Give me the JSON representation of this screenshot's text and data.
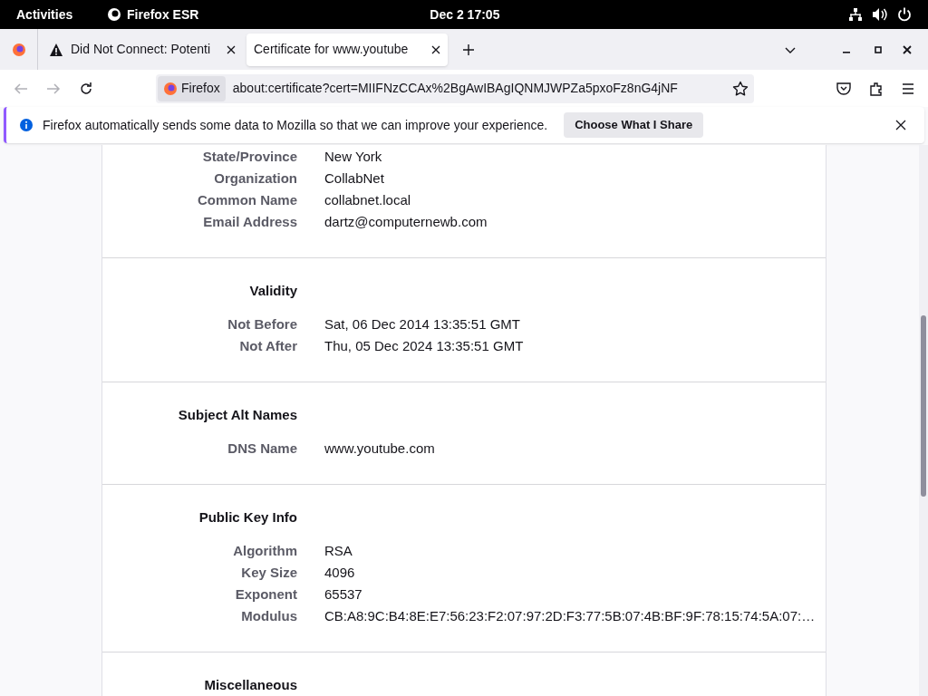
{
  "top_bar": {
    "activities": "Activities",
    "app_name": "Firefox ESR",
    "clock": "Dec 2  17:05"
  },
  "tabs": [
    {
      "title": "Did Not Connect: Potenti",
      "kind": "warning",
      "selected": false
    },
    {
      "title": "Certificate for www.youtube",
      "kind": "page",
      "selected": true
    }
  ],
  "address_bar": {
    "identity": "Firefox",
    "url": "about:certificate?cert=MIIFNzCCAx%2BgAwIBAgIQNMJWPZa5pxoFz8nG4jNF"
  },
  "notification": {
    "message": "Firefox automatically sends some data to Mozilla so that we can improve your experience.",
    "button": "Choose What I Share"
  },
  "sections": [
    {
      "rows": [
        {
          "label": "State/Province",
          "value": "New York"
        },
        {
          "label": "Organization",
          "value": "CollabNet"
        },
        {
          "label": "Common Name",
          "value": "collabnet.local"
        },
        {
          "label": "Email Address",
          "value": "dartz@computernewb.com"
        }
      ]
    },
    {
      "title": "Validity",
      "rows": [
        {
          "label": "Not Before",
          "value": "Sat, 06 Dec 2014 13:35:51 GMT"
        },
        {
          "label": "Not After",
          "value": "Thu, 05 Dec 2024 13:35:51 GMT"
        }
      ]
    },
    {
      "title": "Subject Alt Names",
      "rows": [
        {
          "label": "DNS Name",
          "value": "www.youtube.com"
        }
      ]
    },
    {
      "title": "Public Key Info",
      "rows": [
        {
          "label": "Algorithm",
          "value": "RSA"
        },
        {
          "label": "Key Size",
          "value": "4096"
        },
        {
          "label": "Exponent",
          "value": "65537"
        },
        {
          "label": "Modulus",
          "value": "CB:A8:9C:B4:8E:E7:56:23:F2:07:97:2D:F3:77:5B:07:4B:BF:9F:78:15:74:5A:07:…"
        }
      ]
    },
    {
      "title": "Miscellaneous"
    }
  ]
}
